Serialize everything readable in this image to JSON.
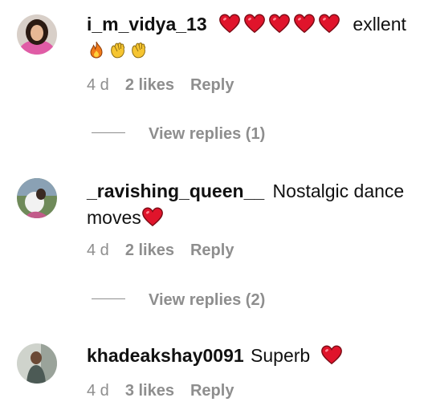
{
  "comments": [
    {
      "username": "i_m_vidya_13",
      "text_after_hearts": "exllent",
      "time": "4 d",
      "likes": "2 likes",
      "reply": "Reply",
      "view_replies": "View replies (1)"
    },
    {
      "username": "_ravishing_queen__",
      "text": "Nostalgic dance",
      "text_line2": "moves",
      "time": "4 d",
      "likes": "2 likes",
      "reply": "Reply",
      "view_replies": "View replies (2)"
    },
    {
      "username": "khadeakshay0091",
      "text": "Superb",
      "time": "4 d",
      "likes": "3 likes",
      "reply": "Reply"
    }
  ],
  "colors": {
    "heart": "#e0142b",
    "meta": "#8e8e8e",
    "text": "#111111"
  },
  "icons": [
    "heart-emoji",
    "fire-emoji",
    "clap-emoji"
  ]
}
